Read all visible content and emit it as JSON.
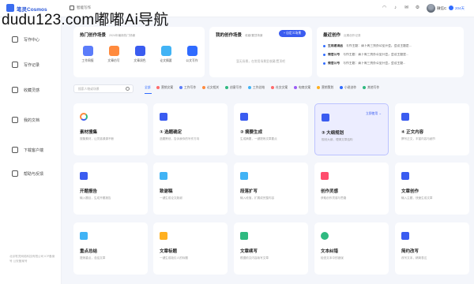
{
  "watermark": "dudu123.com嘟嘟Ai导航",
  "header": {
    "logo": "笔灵Cosmos",
    "breadcrumb": "智能写作",
    "user_name": "微信C",
    "vip_label": "204天"
  },
  "sidebar": {
    "items": [
      {
        "label": "写作中心",
        "active": true
      },
      {
        "label": "写作记录",
        "active": false
      },
      {
        "label": "收藏灵感",
        "active": false
      },
      {
        "label": "我的文档",
        "active": false
      },
      {
        "label": "下载客户端",
        "active": false
      },
      {
        "label": "帮助与反馈",
        "active": false
      }
    ],
    "footer": "北京笔灵网络科技有限公司 ICP备案号 公安备案号"
  },
  "hot_scenes": {
    "title": "热门创作场景",
    "subtitle": "2024年最新热门场景",
    "items": [
      {
        "label": "工作周报",
        "color": "#5b7cfa"
      },
      {
        "label": "文章仿写",
        "color": "#ff8a3d"
      },
      {
        "label": "文章润色",
        "color": "#3a5cf0"
      },
      {
        "label": "论文摘要",
        "color": "#41b3f5"
      },
      {
        "label": "公文写作",
        "color": "#2f6bff"
      }
    ]
  },
  "my_scenes": {
    "title": "我的创作场景",
    "subtitle": "收藏/置顶场景",
    "button": "+ 自定义场景",
    "empty": "暂无场景，在常用场景里收藏/置顶吧"
  },
  "recent": {
    "title": "最近创作",
    "subtitle": "近期创作记录",
    "rows": [
      {
        "tag": "生成邀请函",
        "text": "写作主题：请下周三到办公室开会，会议主题是..."
      },
      {
        "tag": "微信公号",
        "text": "写作主题：请下周三到办公室开会，会议主题是..."
      },
      {
        "tag": "微信公号",
        "text": "写作主题：请下周三到办公室开会，会议主题..."
      }
    ]
  },
  "search": {
    "placeholder": "搜索人物或场景"
  },
  "categories": [
    {
      "label": "全部",
      "color": "",
      "active": true
    },
    {
      "label": "营销文案",
      "color": "#ff6b6b",
      "active": false
    },
    {
      "label": "工作写作",
      "color": "#5b7cfa",
      "active": false
    },
    {
      "label": "论文相关",
      "color": "#ff8a3d",
      "active": false
    },
    {
      "label": "创意写作",
      "color": "#2fb980",
      "active": false
    },
    {
      "label": "工作总结",
      "color": "#41b3f5",
      "active": false
    },
    {
      "label": "社交文案",
      "color": "#ff6b6b",
      "active": false
    },
    {
      "label": "电商文案",
      "color": "#9b5cf6",
      "active": false
    },
    {
      "label": "营销策划",
      "color": "#ffb020",
      "active": false
    },
    {
      "label": "小说创作",
      "color": "#2f6bff",
      "active": false
    },
    {
      "label": "其他写作",
      "color": "#2fb980",
      "active": false
    }
  ],
  "cards": [
    {
      "title": "素材搜集",
      "desc": "搜集素材，让灵感源源不断",
      "icon_color": "#ff8a3d",
      "link": "",
      "highlight": false
    },
    {
      "title": "① 选题确定",
      "desc": "选题策划，告诉我你的写作方向",
      "icon_color": "#3a5cf0",
      "link": "",
      "highlight": false
    },
    {
      "title": "② 摘要生成",
      "desc": "生成摘要，一键提炼文章要点",
      "icon_color": "#3a5cf0",
      "link": "",
      "highlight": false
    },
    {
      "title": "③ 大纲规划",
      "desc": "规划大纲，理清文章结构",
      "icon_color": "#3a5cf0",
      "link": "立即使用 →",
      "highlight": true
    },
    {
      "title": "④ 正文内容",
      "desc": "撰写正文，丰富内容与细节",
      "icon_color": "#3a5cf0",
      "link": "",
      "highlight": false
    },
    {
      "title": "开题报告",
      "desc": "输入题目，生成开题报告",
      "icon_color": "#3a5cf0",
      "link": "",
      "highlight": false
    },
    {
      "title": "致谢稿",
      "desc": "一键生成论文致谢",
      "icon_color": "#41b3f5",
      "link": "",
      "highlight": false
    },
    {
      "title": "段落扩写",
      "desc": "输入段落，扩展成完整内容",
      "icon_color": "#41b3f5",
      "link": "",
      "highlight": false
    },
    {
      "title": "创作灵感",
      "desc": "获取创作灵感与思路",
      "icon_color": "#ff4d6d",
      "link": "",
      "highlight": false
    },
    {
      "title": "文章创作",
      "desc": "输入主题，快速生成文章",
      "icon_color": "#3a5cf0",
      "link": "",
      "highlight": false
    },
    {
      "title": "重点总结",
      "desc": "提炼重点，总结文章",
      "icon_color": "#41b3f5",
      "link": "",
      "highlight": false
    },
    {
      "title": "文章标题",
      "desc": "一键生成吸引人的标题",
      "icon_color": "#ffb020",
      "link": "",
      "highlight": false
    },
    {
      "title": "文章续写",
      "desc": "根据前文内容续写文章",
      "icon_color": "#2fb980",
      "link": "",
      "highlight": false
    },
    {
      "title": "文本纠错",
      "desc": "检查文本中的错误",
      "icon_color": "#2fb980",
      "link": "",
      "highlight": false
    },
    {
      "title": "简约改写",
      "desc": "改写文本，精简表达",
      "icon_color": "#3a5cf0",
      "link": "",
      "highlight": false
    }
  ]
}
